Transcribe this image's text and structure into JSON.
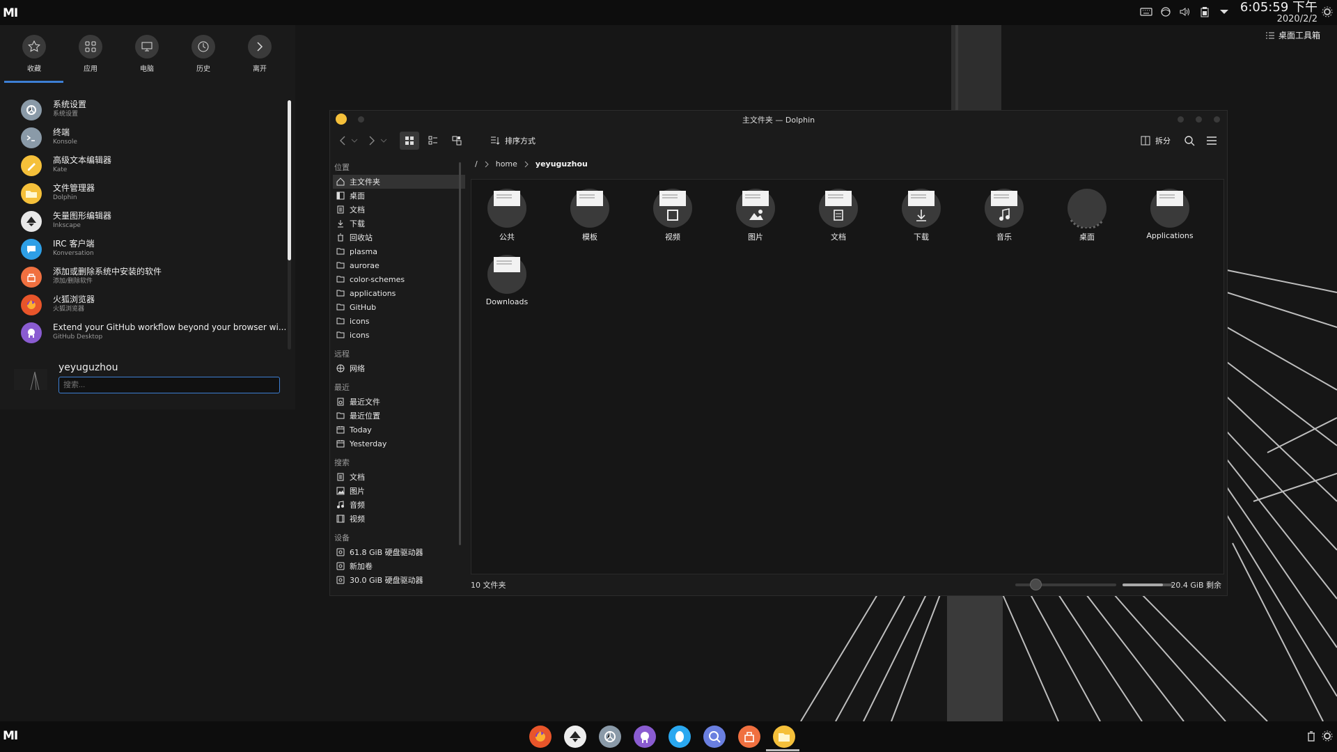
{
  "top_panel": {
    "logo": "MI",
    "tray_icons": [
      "keyboard-icon",
      "network-icon",
      "volume-icon",
      "clipboard-icon",
      "expand-arrow-icon"
    ],
    "clock_time": "6:05:59 下午",
    "clock_date": "2020/2/2",
    "desktop_toolbox": "桌面工具箱"
  },
  "launcher": {
    "tabs": [
      {
        "label": "收藏",
        "icon": "star-icon"
      },
      {
        "label": "应用",
        "icon": "grid-icon"
      },
      {
        "label": "电脑",
        "icon": "monitor-icon"
      },
      {
        "label": "历史",
        "icon": "clock-icon"
      },
      {
        "label": "离开",
        "icon": "chevron-right-icon"
      }
    ],
    "apps": [
      {
        "name": "系统设置",
        "sub": "系统设置",
        "color": "#8a9aa8",
        "icon": "settings-icon"
      },
      {
        "name": "终端",
        "sub": "Konsole",
        "color": "#8a9aa8",
        "icon": "terminal-icon"
      },
      {
        "name": "高级文本编辑器",
        "sub": "Kate",
        "color": "#f5c03a",
        "icon": "pen-icon"
      },
      {
        "name": "文件管理器",
        "sub": "Dolphin",
        "color": "#f5c03a",
        "icon": "folder-icon"
      },
      {
        "name": "矢量图形编辑器",
        "sub": "Inkscape",
        "color": "#e8e8e8",
        "icon": "inkscape-icon"
      },
      {
        "name": "IRC 客户端",
        "sub": "Konversation",
        "color": "#2e9fe6",
        "icon": "chat-icon"
      },
      {
        "name": "添加或删除系统中安装的软件",
        "sub": "添加/删除软件",
        "color": "#f07040",
        "icon": "software-icon"
      },
      {
        "name": "火狐浏览器",
        "sub": "火狐浏览器",
        "color": "#e8552a",
        "icon": "firefox-icon"
      },
      {
        "name": "Extend your GitHub workflow beyond your browser wi...",
        "sub": "GitHub Desktop",
        "color": "#8a5cd1",
        "icon": "github-icon"
      }
    ],
    "user_name": "yeyuguzhou",
    "search_placeholder": "搜索..."
  },
  "dolphin": {
    "title": "主文件夹 — Dolphin",
    "sort_label": "排序方式",
    "split_label": "拆分",
    "places": [
      {
        "section": "位置",
        "items": [
          {
            "label": "主文件夹",
            "icon": "home-icon",
            "selected": true
          },
          {
            "label": "桌面",
            "icon": "desktop-icon"
          },
          {
            "label": "文档",
            "icon": "document-icon"
          },
          {
            "label": "下载",
            "icon": "download-icon"
          },
          {
            "label": "回收站",
            "icon": "trash-icon"
          },
          {
            "label": "plasma",
            "icon": "folder-icon"
          },
          {
            "label": "aurorae",
            "icon": "folder-icon"
          },
          {
            "label": "color-schemes",
            "icon": "folder-icon"
          },
          {
            "label": "applications",
            "icon": "folder-icon"
          },
          {
            "label": "GitHub",
            "icon": "folder-icon"
          },
          {
            "label": "icons",
            "icon": "folder-icon"
          },
          {
            "label": "icons",
            "icon": "folder-icon"
          }
        ]
      },
      {
        "section": "远程",
        "items": [
          {
            "label": "网络",
            "icon": "network-icon"
          }
        ]
      },
      {
        "section": "最近",
        "items": [
          {
            "label": "最近文件",
            "icon": "recent-files-icon"
          },
          {
            "label": "最近位置",
            "icon": "recent-places-icon"
          },
          {
            "label": "Today",
            "icon": "calendar-icon"
          },
          {
            "label": "Yesterday",
            "icon": "calendar-icon"
          }
        ]
      },
      {
        "section": "搜索",
        "items": [
          {
            "label": "文档",
            "icon": "document-icon"
          },
          {
            "label": "图片",
            "icon": "image-icon"
          },
          {
            "label": "音频",
            "icon": "audio-icon"
          },
          {
            "label": "视频",
            "icon": "video-icon"
          }
        ]
      },
      {
        "section": "设备",
        "items": [
          {
            "label": "61.8 GiB 硬盘驱动器",
            "icon": "drive-icon"
          },
          {
            "label": "新加卷",
            "icon": "drive-icon"
          },
          {
            "label": "30.0 GiB 硬盘驱动器",
            "icon": "drive-icon"
          }
        ]
      }
    ],
    "breadcrumb": [
      "/",
      "home",
      "yeyuguzhou"
    ],
    "files": [
      {
        "label": "公共",
        "icon": "folder-public-icon"
      },
      {
        "label": "模板",
        "icon": "folder-templates-icon"
      },
      {
        "label": "视频",
        "icon": "folder-video-icon"
      },
      {
        "label": "图片",
        "icon": "folder-pictures-icon"
      },
      {
        "label": "文档",
        "icon": "folder-documents-icon"
      },
      {
        "label": "下载",
        "icon": "folder-download-icon"
      },
      {
        "label": "音乐",
        "icon": "folder-music-icon"
      },
      {
        "label": "桌面",
        "icon": "folder-desktop-icon"
      },
      {
        "label": "Applications",
        "icon": "folder-icon"
      },
      {
        "label": "Downloads",
        "icon": "folder-icon"
      }
    ],
    "status_text": "10 文件夹",
    "free_space": "20.4 GiB 剩余",
    "zoom_fraction": 0.2,
    "free_fraction": 0.8
  },
  "dock": {
    "logo": "MI",
    "icons": [
      {
        "name": "firefox-icon",
        "color": "#e8552a"
      },
      {
        "name": "inkscape-icon",
        "color": "#eeeeee"
      },
      {
        "name": "settings-icon",
        "color": "#8a9aa8"
      },
      {
        "name": "github-icon",
        "color": "#8a5cd1"
      },
      {
        "name": "qq-icon",
        "color": "#2aa8f0"
      },
      {
        "name": "network-search-icon",
        "color": "#6a7fe0"
      },
      {
        "name": "software-icon",
        "color": "#f07040"
      },
      {
        "name": "dolphin-icon",
        "color": "#f5c03a"
      }
    ],
    "right_icons": [
      "trash-icon",
      "gear-icon"
    ]
  }
}
